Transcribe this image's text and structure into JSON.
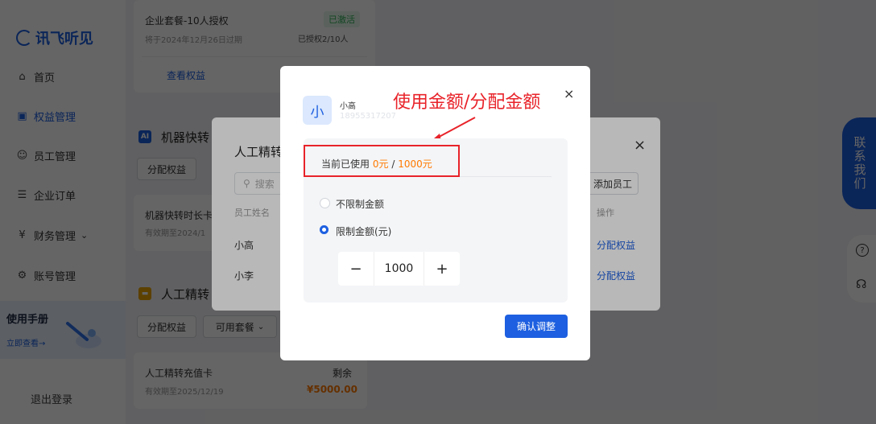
{
  "sidebar": {
    "logo": "讯飞听见",
    "items": [
      {
        "label": "首页",
        "icon": "home-icon",
        "glyph": "⌂"
      },
      {
        "label": "权益管理",
        "icon": "benefit-icon",
        "glyph": "▣"
      },
      {
        "label": "员工管理",
        "icon": "user-icon",
        "glyph": "☺"
      },
      {
        "label": "企业订单",
        "icon": "order-icon",
        "glyph": "☰"
      },
      {
        "label": "财务管理",
        "icon": "finance-icon",
        "glyph": "¥",
        "caret": "⌄"
      },
      {
        "label": "账号管理",
        "icon": "settings-icon",
        "glyph": "⚙"
      }
    ],
    "manual_title": "使用手册",
    "manual_link": "立即查看→",
    "logout": "退出登录"
  },
  "top_card": {
    "title": "企业套餐-10人授权",
    "status": "已激活",
    "expiry": "将于2024年12月26日过期",
    "authorized": "已授权2/10人",
    "view_button": "查看权益"
  },
  "section_machine": {
    "badge": "AI",
    "title": "机器快转",
    "allocate_button": "分配权益",
    "item_title": "机器快转时长卡",
    "item_expiry": "有效期至2024/1"
  },
  "section_human": {
    "title": "人工精转",
    "allocate_button": "分配权益",
    "plan_select": "可用套餐",
    "plan_caret": "⌄",
    "item_title": "人工精转充值卡",
    "remaining_label": "剩余",
    "remaining_value": "¥5000.00",
    "item_expiry": "有效期至2025/12/19"
  },
  "back_dialog": {
    "title": "人工精转",
    "close": "×",
    "search_placeholder": "搜索",
    "add_employee": "添加员工",
    "col_name": "员工姓名",
    "col_action": "操作",
    "rows": [
      {
        "name": "小高",
        "action": "分配权益"
      },
      {
        "name": "小李",
        "action": "分配权益"
      }
    ]
  },
  "front_dialog": {
    "avatar": "小",
    "user_name": "小高",
    "user_phone": "18955317207",
    "close": "×",
    "annotation": "使用金额/分配金额",
    "used_label": "当前已使用",
    "used_value": "0元",
    "separator": "/",
    "total_value": "1000元",
    "option_unlimited": "不限制金额",
    "option_limited": "限制金额(元)",
    "stepper_minus": "−",
    "stepper_value": "1000",
    "stepper_plus": "+",
    "confirm": "确认调整"
  },
  "floating": {
    "contact": "联系我们",
    "help": "?",
    "support": "☊"
  },
  "colors": {
    "brand": "#1d5fe0",
    "success": "#2fb35a",
    "orange": "#ff7a00",
    "annotation_red": "#e8232a"
  }
}
